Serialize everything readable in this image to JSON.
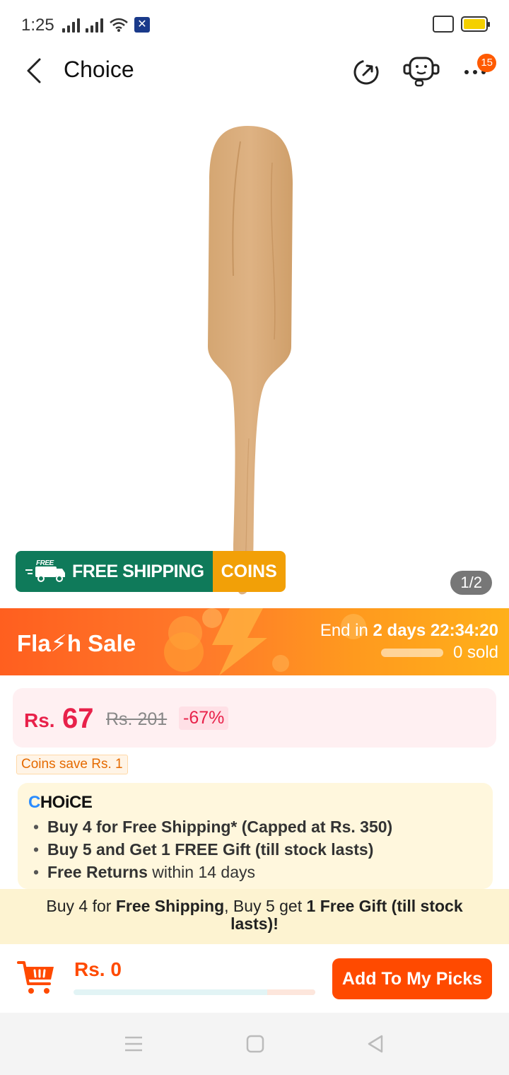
{
  "status_bar": {
    "time": "1:25",
    "battery_level": 1.0
  },
  "header": {
    "title": "Choice",
    "notification_count": "15"
  },
  "product": {
    "image_counter": "1/2",
    "free_shipping_label": "FREE SHIPPING",
    "free_tag": "FREE",
    "coins_label": "COINS"
  },
  "flash_sale": {
    "title": "Fla⚡h  Sale",
    "end_prefix": "End in ",
    "end_days": "2 days",
    "end_time": "22:34:20",
    "sold": "0 sold"
  },
  "price": {
    "currency": "Rs.",
    "current": "67",
    "original": "Rs. 201",
    "discount": "-67%",
    "coins_save": "Coins save Rs. 1"
  },
  "choice": {
    "logo": "CHOiCE",
    "items": [
      {
        "bold": "Buy 4 for  Free Shipping* (Capped at Rs. 350)",
        "rest": ""
      },
      {
        "bold": "Buy 5 and Get 1 FREE Gift (till stock lasts)",
        "rest": ""
      },
      {
        "bold": "Free Returns",
        "rest": " within 14 days"
      }
    ]
  },
  "promo": {
    "part1": "Buy 4 for ",
    "bold1": "Free Shipping",
    "part2": ", Buy 5 get ",
    "bold2": "1 Free Gift (till stock lasts)!"
  },
  "bottom": {
    "cart_total": "Rs. 0",
    "add_button": "Add To My Picks"
  },
  "colors": {
    "accent": "#ff4a00",
    "price_red": "#e8214a",
    "shipping_green": "#0f7a5a",
    "coins_orange": "#f2a007"
  }
}
